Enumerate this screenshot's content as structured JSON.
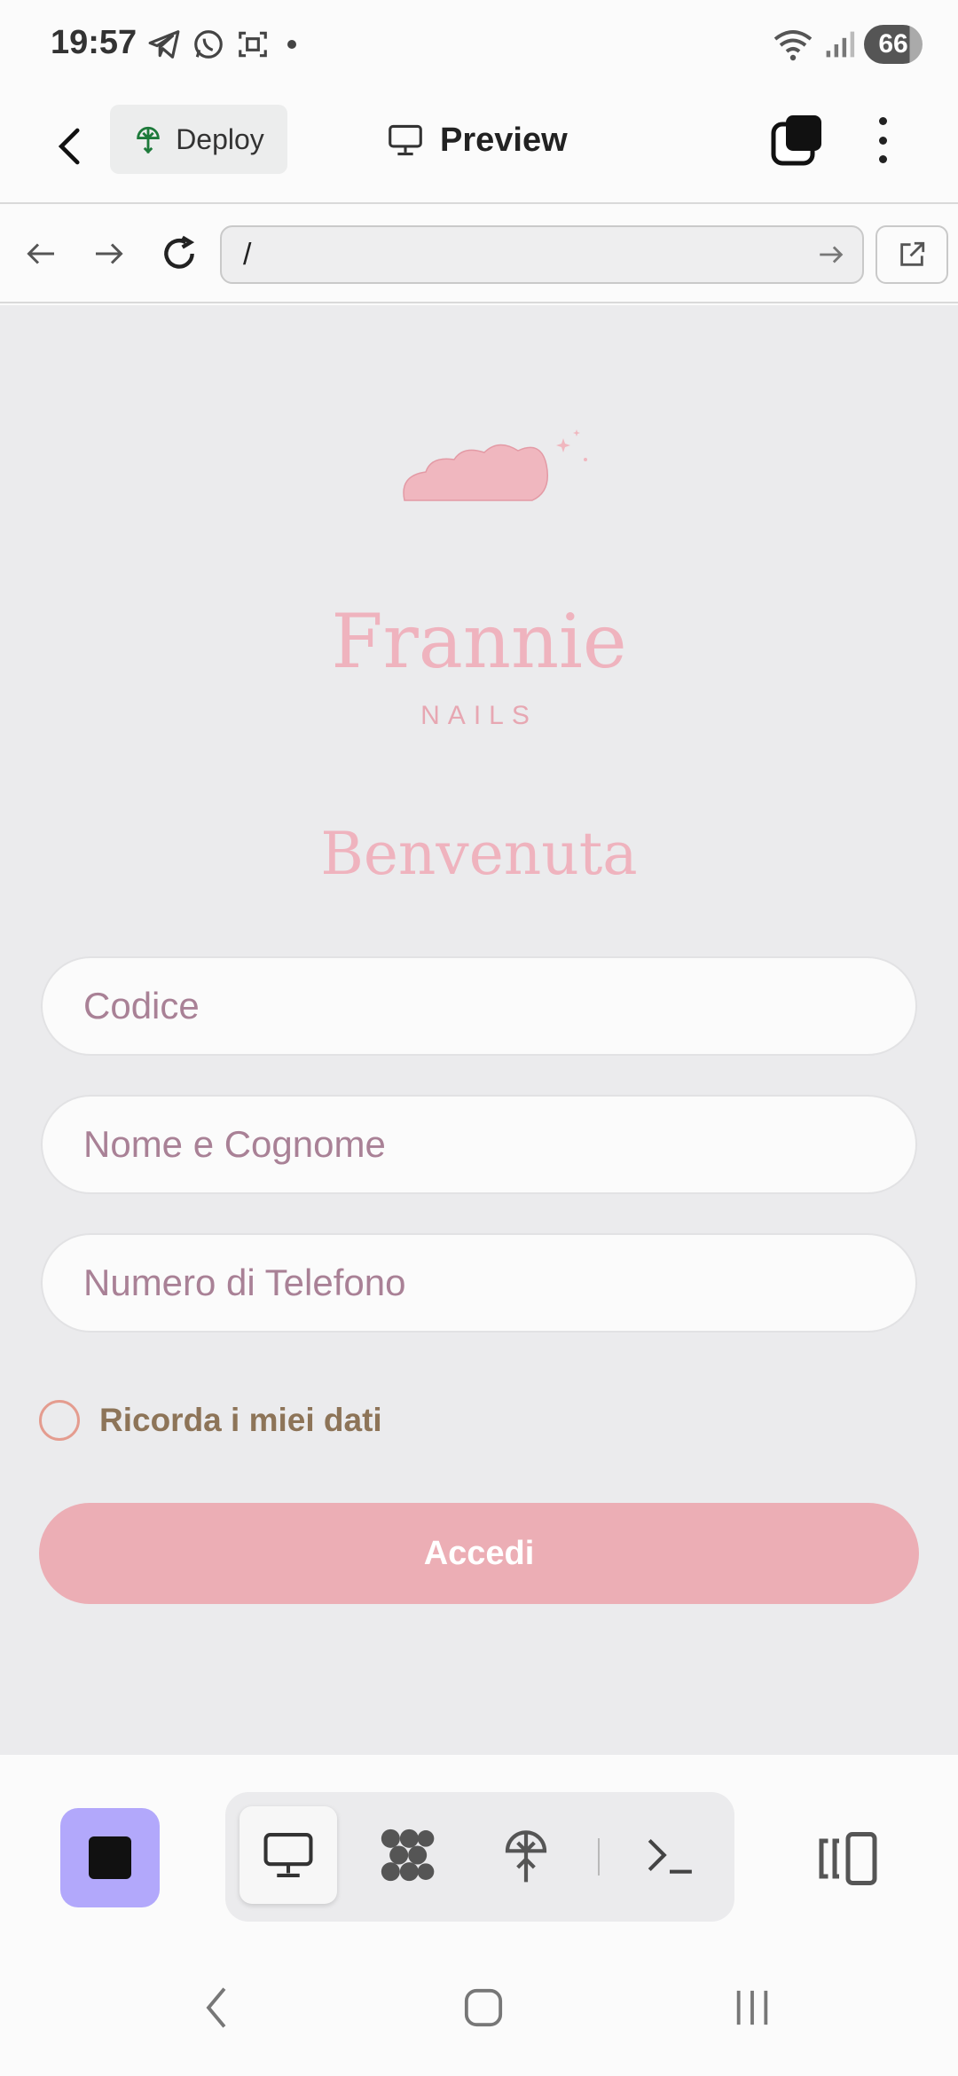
{
  "status": {
    "time": "19:57",
    "battery": "66"
  },
  "app_bar": {
    "deploy_label": "Deploy",
    "title": "Preview"
  },
  "browser": {
    "url": "/"
  },
  "page": {
    "brand_name": "Frannie",
    "brand_sub": "NAILS",
    "welcome": "Benvenuta",
    "fields": {
      "code_placeholder": "Codice",
      "name_placeholder": "Nome e Cognome",
      "phone_placeholder": "Numero di Telefono"
    },
    "remember_label": "Ricorda i miei dati",
    "submit_label": "Accedi"
  },
  "toolbar": {
    "tools": [
      "monitor-icon",
      "extensions-icon",
      "deploy-icon",
      "terminal-icon"
    ],
    "active_tool": "monitor-icon"
  },
  "colors": {
    "accent_pink": "#ecaeb5",
    "brand_pink": "#efb3be",
    "stop_purple": "#b2a8fb"
  }
}
